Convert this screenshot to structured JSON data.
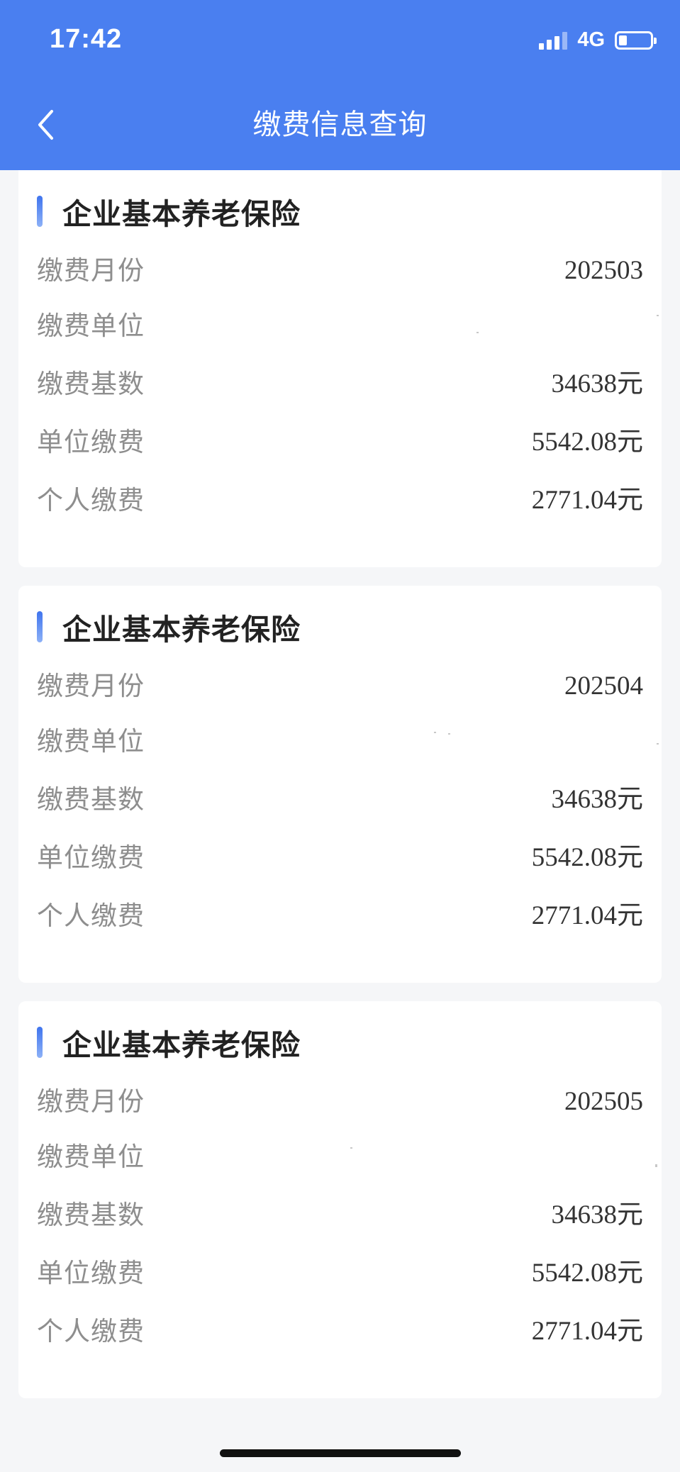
{
  "status_bar": {
    "time": "17:42",
    "network": "4G",
    "battery_level": 0.25
  },
  "header": {
    "back_icon": "chevron-left-icon",
    "title": "缴费信息查询"
  },
  "colors": {
    "header_bg": "#4a7ff0",
    "accent": "#3f74ee",
    "page_bg": "#f5f6f8"
  },
  "records": [
    {
      "title": "企业基本养老保险",
      "fields": [
        {
          "label": "缴费月份",
          "value": "202503"
        },
        {
          "label": "缴费单位",
          "value": ""
        },
        {
          "label": "缴费基数",
          "value": "34638元"
        },
        {
          "label": "单位缴费",
          "value": "5542.08元"
        },
        {
          "label": "个人缴费",
          "value": "2771.04元"
        }
      ]
    },
    {
      "title": "企业基本养老保险",
      "fields": [
        {
          "label": "缴费月份",
          "value": "202504"
        },
        {
          "label": "缴费单位",
          "value": ""
        },
        {
          "label": "缴费基数",
          "value": "34638元"
        },
        {
          "label": "单位缴费",
          "value": "5542.08元"
        },
        {
          "label": "个人缴费",
          "value": "2771.04元"
        }
      ]
    },
    {
      "title": "企业基本养老保险",
      "fields": [
        {
          "label": "缴费月份",
          "value": "202505"
        },
        {
          "label": "缴费单位",
          "value": ""
        },
        {
          "label": "缴费基数",
          "value": "34638元"
        },
        {
          "label": "单位缴费",
          "value": "5542.08元"
        },
        {
          "label": "个人缴费",
          "value": "2771.04元"
        }
      ]
    }
  ]
}
